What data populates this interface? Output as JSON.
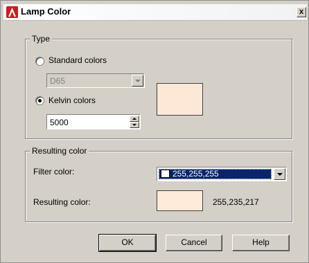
{
  "window": {
    "title": "Lamp Color",
    "close_label": "x"
  },
  "type_group": {
    "label": "Type",
    "standard": {
      "label": "Standard colors",
      "selected": false,
      "dropdown_value": "D65",
      "enabled": false
    },
    "kelvin": {
      "label": "Kelvin colors",
      "selected": true,
      "value": "5000"
    },
    "preview_color": "#fde8d8"
  },
  "result_group": {
    "label": "Resulting color",
    "filter_label": "Filter color:",
    "filter_value": "255,255,255",
    "filter_color": "#ffffff",
    "result_label": "Resulting color:",
    "result_value": "255,235,217",
    "result_color": "#ffebd9"
  },
  "buttons": {
    "ok": "OK",
    "cancel": "Cancel",
    "help": "Help"
  },
  "colors": {
    "dialog_bg": "#d4d0c8",
    "selection": "#0a246a",
    "icon": "#c81e1e"
  },
  "icons": {
    "app": "autocad-icon",
    "close": "close-icon",
    "dropdown": "chevron-down-icon"
  }
}
